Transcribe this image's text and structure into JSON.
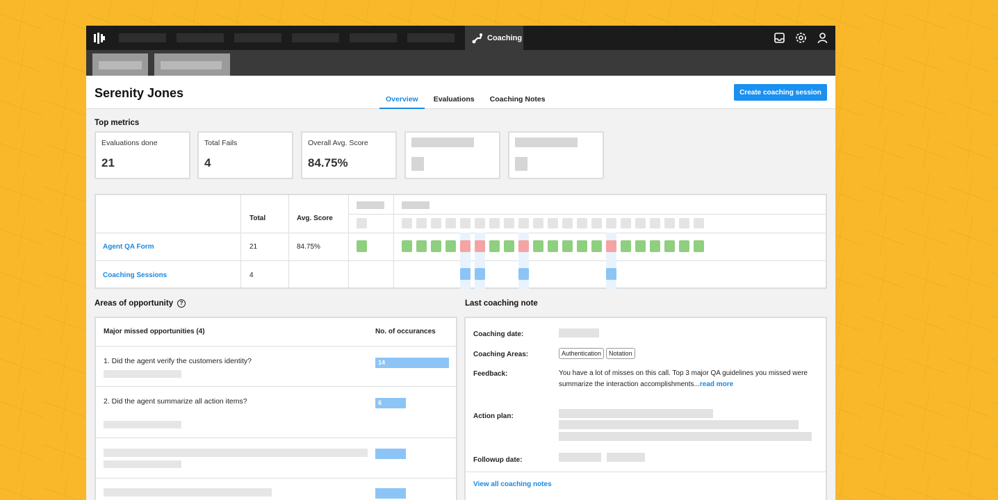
{
  "nav": {
    "active_tab_label": "Coaching",
    "icons": [
      "inbox-icon",
      "gear-icon",
      "user-icon"
    ]
  },
  "header": {
    "agent_name": "Serenity Jones",
    "tabs": [
      {
        "label": "Overview",
        "active": true
      },
      {
        "label": "Evaluations",
        "active": false
      },
      {
        "label": "Coaching Notes",
        "active": false
      }
    ],
    "create_button_label": "Create coaching session"
  },
  "top_metrics": {
    "title": "Top metrics",
    "cards": [
      {
        "label": "Evaluations done",
        "value": "21"
      },
      {
        "label": "Total Fails",
        "value": "4"
      },
      {
        "label": "Overall Avg. Score",
        "value": "84.75%"
      }
    ]
  },
  "summary_table": {
    "headers": {
      "total": "Total",
      "avg_score": "Avg. Score"
    },
    "rows": [
      {
        "name": "Agent QA Form",
        "total": "21",
        "avg_score": "84.75%"
      },
      {
        "name": "Coaching Sessions",
        "total": "4",
        "avg_score": ""
      }
    ],
    "evaluation_results": [
      "pass",
      "pass",
      "pass",
      "pass",
      "fail",
      "fail",
      "pass",
      "pass",
      "fail",
      "pass",
      "pass",
      "pass",
      "pass",
      "pass",
      "fail",
      "pass",
      "pass",
      "pass",
      "pass",
      "pass",
      "pass"
    ],
    "coaching_session_indexes": [
      4,
      5,
      8,
      14
    ],
    "colors": {
      "pass": "#8fcf7f",
      "fail": "#f5a3a3",
      "coaching": "#8cc4f6"
    }
  },
  "opportunities": {
    "title": "Areas of opportunity",
    "col_question": "Major missed opportunities (4)",
    "col_count": "No. of occurances",
    "items": [
      {
        "question": "1. Did the agent verify the customers identity?",
        "count": "14",
        "count_value": 14
      },
      {
        "question": "2. Did the agent summarize all action items?",
        "count": "6",
        "count_value": 6
      }
    ]
  },
  "last_note": {
    "title": "Last coaching note",
    "date_label": "Coaching date:",
    "areas_label": "Coaching Areas:",
    "areas": [
      "Authentication",
      "Notation"
    ],
    "feedback_label": "Feedback:",
    "feedback_text": "You have a lot of misses on this call. Top 3 major QA guidelines you missed were summarize the interaction accomplishments...",
    "read_more": "read more",
    "action_plan_label": "Action plan:",
    "followup_label": "Followup date:",
    "view_all": "View all coaching notes"
  },
  "accent_color": "#1a88e0"
}
